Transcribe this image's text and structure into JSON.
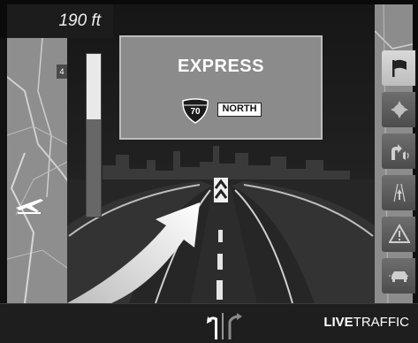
{
  "distance": {
    "value": "190 ft"
  },
  "progress": {
    "fraction": 0.6
  },
  "sign": {
    "title": "EXPRESS",
    "route_number": "70",
    "direction": "NORTH",
    "shield_icon": "interstate-shield-icon"
  },
  "side_menu": {
    "items": [
      {
        "name": "destination-flag-icon",
        "active": true
      },
      {
        "name": "map-position-icon",
        "active": false
      },
      {
        "name": "turn-announcement-icon",
        "active": false
      },
      {
        "name": "lane-guidance-icon",
        "active": false
      },
      {
        "name": "warning-icon",
        "active": false
      },
      {
        "name": "traffic-car-icon",
        "active": false
      }
    ]
  },
  "bottom_bar": {
    "live_bold": "LIVE",
    "live_rest": "TRAFFIC",
    "lane_icon": "lane-split-icon"
  },
  "map": {
    "left_route_label": "4",
    "left_poi_icon": "airport-icon"
  },
  "colors": {
    "route_arrow": "#f2f2f2",
    "sign_bg": "#8b8b8b",
    "road": "#2f2f2f"
  }
}
